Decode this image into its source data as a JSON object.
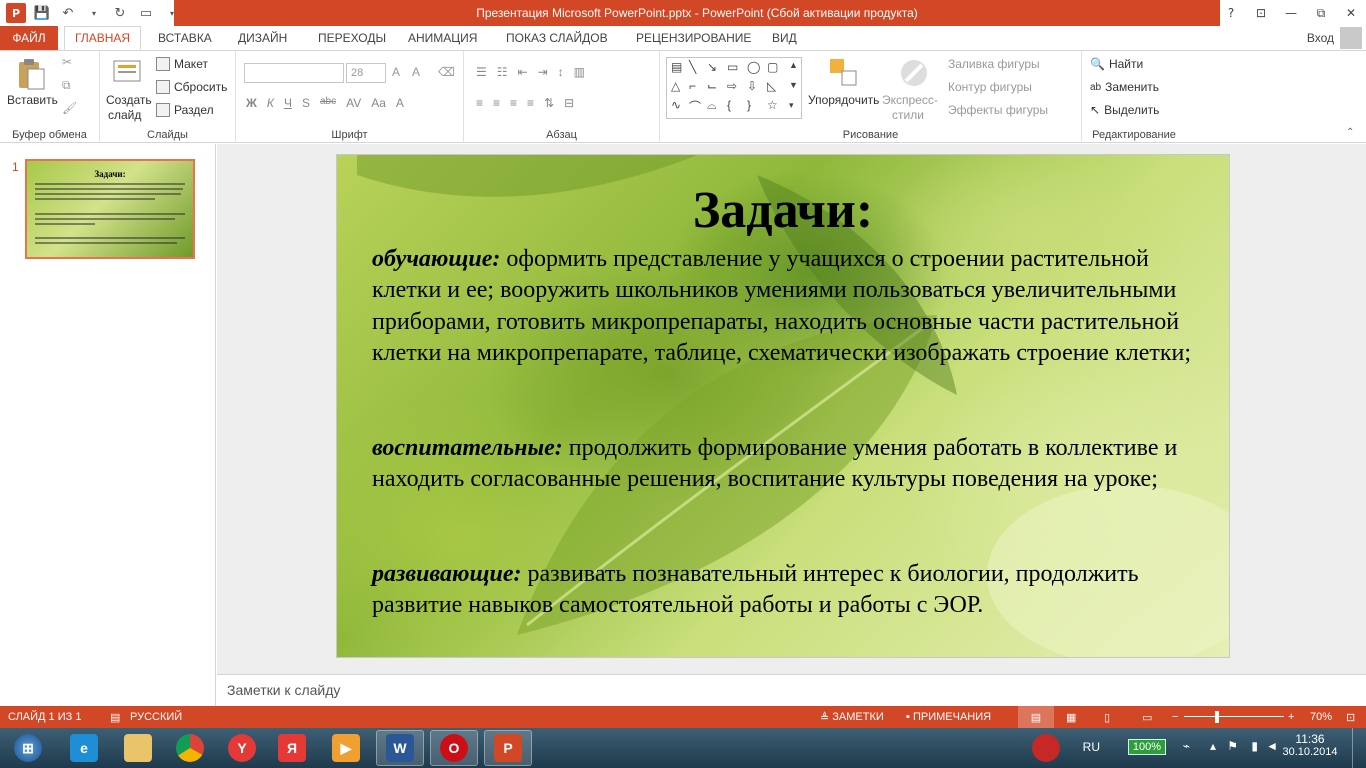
{
  "window": {
    "title": "Презентация Microsoft PowerPoint.pptx -  PowerPoint (Сбой активации продукта)",
    "controls": {
      "help": "?",
      "restore_ribbon": "⊡",
      "minimize": "—",
      "maximize": "⧉",
      "close": "✕"
    }
  },
  "tabs": [
    {
      "label": "ФАЙЛ"
    },
    {
      "label": "ГЛАВНАЯ"
    },
    {
      "label": "ВСТАВКА"
    },
    {
      "label": "ДИЗАЙН"
    },
    {
      "label": "ПЕРЕХОДЫ"
    },
    {
      "label": "АНИМАЦИЯ"
    },
    {
      "label": "ПОКАЗ СЛАЙДОВ"
    },
    {
      "label": "РЕЦЕНЗИРОВАНИЕ"
    },
    {
      "label": "ВИД"
    }
  ],
  "signin": "Вход",
  "ribbon": {
    "clipboard": {
      "paste": "Вставить",
      "label": "Буфер обмена"
    },
    "slides": {
      "new_slide_1": "Создать",
      "new_slide_2": "слайд",
      "layout": "Макет",
      "reset": "Сбросить",
      "section": "Раздел",
      "label": "Слайды"
    },
    "font": {
      "font_name": "",
      "font_size": "28",
      "bold": "Ж",
      "italic": "К",
      "underline": "Ч",
      "shadow": "S",
      "strike": "abc",
      "spacing": "AV",
      "case": "Aa",
      "color": "A",
      "grow": "A",
      "shrink": "A",
      "label": "Шрифт"
    },
    "paragraph": {
      "label": "Абзац"
    },
    "drawing": {
      "arrange": "Упорядочить",
      "quick_styles_1": "Экспресс-",
      "quick_styles_2": "стили",
      "fill": "Заливка фигуры",
      "outline": "Контур фигуры",
      "effects": "Эффекты фигуры",
      "label": "Рисование"
    },
    "editing": {
      "find": "Найти",
      "replace": "Заменить",
      "select": "Выделить",
      "label": "Редактирование"
    }
  },
  "thumbnail": {
    "number": "1",
    "title": "Задачи:"
  },
  "slide": {
    "title": "Задачи:",
    "paragraphs": [
      {
        "label": "обучающие:",
        "text": "  оформить представление у учащихся о строении растительной клетки и ее; вооружить школьников умениями пользоваться увеличительными приборами, готовить микропрепараты, находить основные части растительной клетки на микропрепарате, таблице, схематически изображать строение клетки;"
      },
      {
        "label": "воспитательные:",
        "text": "  продолжить формирование умения работать в коллективе и находить согласованные решения, воспитание культуры поведения на уроке;"
      },
      {
        "label": "развивающие:",
        "text": "  развивать познавательный интерес к биологии, продолжить развитие навыков самостоятельной работы и работы с ЭОР."
      }
    ]
  },
  "notes_placeholder": "Заметки к слайду",
  "statusbar": {
    "slide_info": "СЛАЙД 1 ИЗ 1",
    "language": "РУССКИЙ",
    "notes": "ЗАМЕТКИ",
    "comments": "ПРИМЕЧАНИЯ",
    "zoom": "70%",
    "zoom_level": 0.7
  },
  "taskbar": {
    "lang": "RU",
    "battery": "100%",
    "time": "11:36",
    "date": "30.10.2014"
  }
}
